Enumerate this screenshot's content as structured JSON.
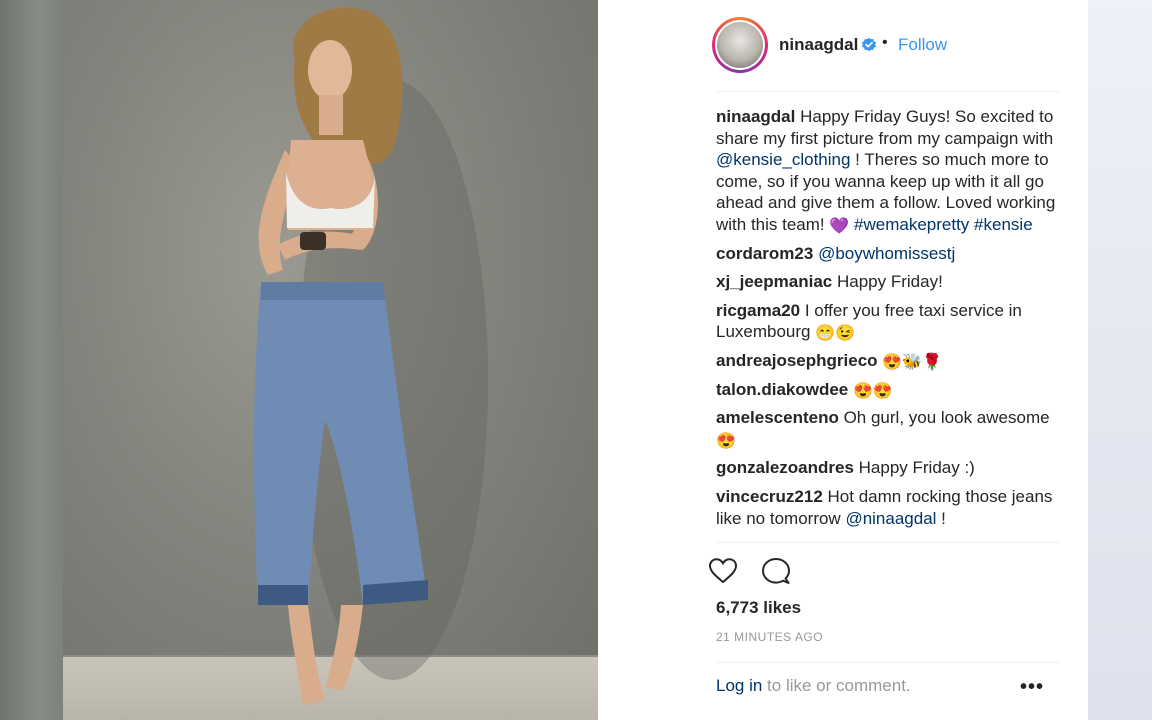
{
  "post": {
    "username": "nina​agdal",
    "follow_label": "Follow",
    "separator": "•"
  },
  "comments": [
    {
      "user": "nina​agdal",
      "parts": [
        {
          "t": " Happy Friday Guys! So excited to share my first picture from my campaign with "
        },
        {
          "t": "@kensie_clothing",
          "link": true
        },
        {
          "t": " ! Theres so much more to come, so if you wanna keep up with it all go ahead and give them a follow. Loved working with this team! "
        },
        {
          "t": "💜",
          "emoji": true
        },
        {
          "t": " "
        },
        {
          "t": "#wemakepretty",
          "link": true
        },
        {
          "t": " "
        },
        {
          "t": "#kensie",
          "link": true
        }
      ]
    },
    {
      "user": "cordarom23",
      "parts": [
        {
          "t": " "
        },
        {
          "t": "@boywhomissestj",
          "link": true
        }
      ]
    },
    {
      "user": "xj_jeepmaniac",
      "parts": [
        {
          "t": " Happy Friday!"
        }
      ]
    },
    {
      "user": "ricgama20",
      "parts": [
        {
          "t": " I offer you free taxi service in Luxembourg "
        },
        {
          "t": "😁😉",
          "emoji": true
        }
      ]
    },
    {
      "user": "andreajosephgrieco",
      "parts": [
        {
          "t": " "
        },
        {
          "t": "😍🐝🌹",
          "emoji": true
        }
      ]
    },
    {
      "user": "talon.diakowdee",
      "parts": [
        {
          "t": " "
        },
        {
          "t": "😍😍",
          "emoji": true
        }
      ]
    },
    {
      "user": "amelescenteno",
      "parts": [
        {
          "t": " Oh gurl, you look awesome "
        },
        {
          "t": "😍",
          "emoji": true
        }
      ]
    },
    {
      "user": "gonzalezoandres",
      "parts": [
        {
          "t": " Happy Friday :)"
        }
      ]
    },
    {
      "user": "vincecruz212",
      "parts": [
        {
          "t": " Hot damn rocking those jeans like no tomorrow "
        },
        {
          "t": "@ninaagdal",
          "link": true
        },
        {
          "t": " !"
        }
      ]
    }
  ],
  "likes_text": "6,773 likes",
  "timestamp": "21 MINUTES AGO",
  "login": {
    "link": "Log in",
    "rest": " to like or comment."
  },
  "more_label": "•••",
  "icons": {
    "like": "heart-outline-icon",
    "comment": "speech-bubble-icon",
    "verified": "verified-badge-icon",
    "more": "more-options-icon"
  },
  "colors": {
    "link": "#003569",
    "follow": "#3897f0",
    "verified": "#3897f0",
    "muted": "#999999"
  }
}
